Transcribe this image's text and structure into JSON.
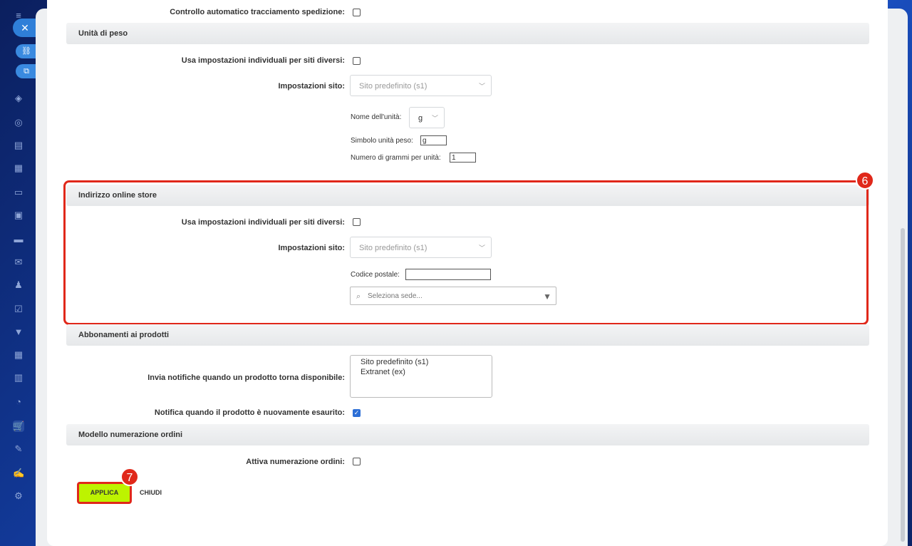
{
  "top_row": {
    "label": "Controllo automatico tracciamento spedizione:"
  },
  "weight": {
    "title": "Unità di peso",
    "individual_label": "Usa impostazioni individuali per siti diversi:",
    "site_label": "Impostazioni sito:",
    "site_value": "Sito predefinito (s1)",
    "unit_name_label": "Nome dell'unità:",
    "unit_name_value": "g",
    "symbol_label": "Simbolo unità peso:",
    "symbol_value": "g",
    "grams_label": "Numero di grammi per unità:",
    "grams_value": "1"
  },
  "store_address": {
    "title": "Indirizzo online store",
    "individual_label": "Usa impostazioni individuali per siti diversi:",
    "site_label": "Impostazioni sito:",
    "site_value": "Sito predefinito (s1)",
    "postal_label": "Codice postale:",
    "postal_value": "",
    "location_placeholder": "Seleziona sede...",
    "badge": "6"
  },
  "subscriptions": {
    "title": "Abbonamenti ai prodotti",
    "notify_label": "Invia notifiche quando un prodotto torna disponibile:",
    "sites": [
      "Sito predefinito (s1)",
      "Extranet (ex)"
    ],
    "soldout_label": "Notifica quando il prodotto è nuovamente esaurito:"
  },
  "numbering": {
    "title": "Modello numerazione ordini",
    "enable_label": "Attiva numerazione ordini:"
  },
  "buttons": {
    "apply": "APPLICA",
    "close": "CHIUDI",
    "badge": "7"
  },
  "colors": {
    "highlight": "#e0281a",
    "apply_bg": "#bdf300",
    "accent": "#2d6fd6"
  }
}
